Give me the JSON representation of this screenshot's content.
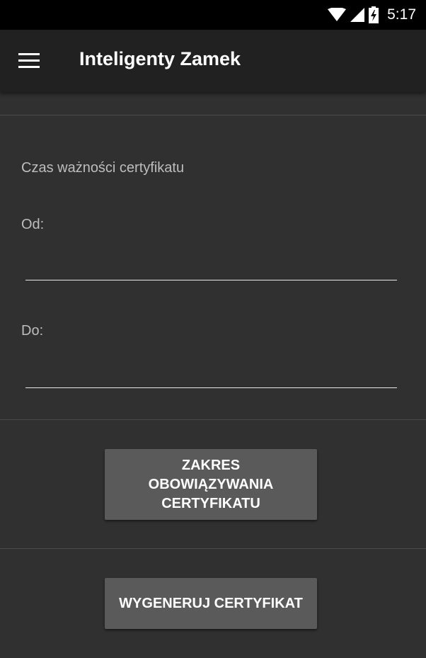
{
  "status_bar": {
    "time": "5:17",
    "icons": [
      "wifi-icon",
      "cellular-signal-icon",
      "battery-charging-icon"
    ]
  },
  "app_bar": {
    "title": "Inteligenty Zamek",
    "menu_icon": "hamburger-menu-icon"
  },
  "form": {
    "section_label": "Czas ważności certyfikatu",
    "from_label": "Od:",
    "from_value": "",
    "to_label": "Do:",
    "to_value": ""
  },
  "buttons": {
    "validity_range_label": "ZAKRES OBOWIĄZYWANIA CERTYFIKATU",
    "generate_label": "WYGENERUJ CERTYFIKAT"
  },
  "colors": {
    "background": "#303030",
    "app_bar": "#212121",
    "status_bar": "#000000",
    "button": "#5a5a5a",
    "text_primary": "#ffffff",
    "text_secondary": "#bdbdbd"
  }
}
